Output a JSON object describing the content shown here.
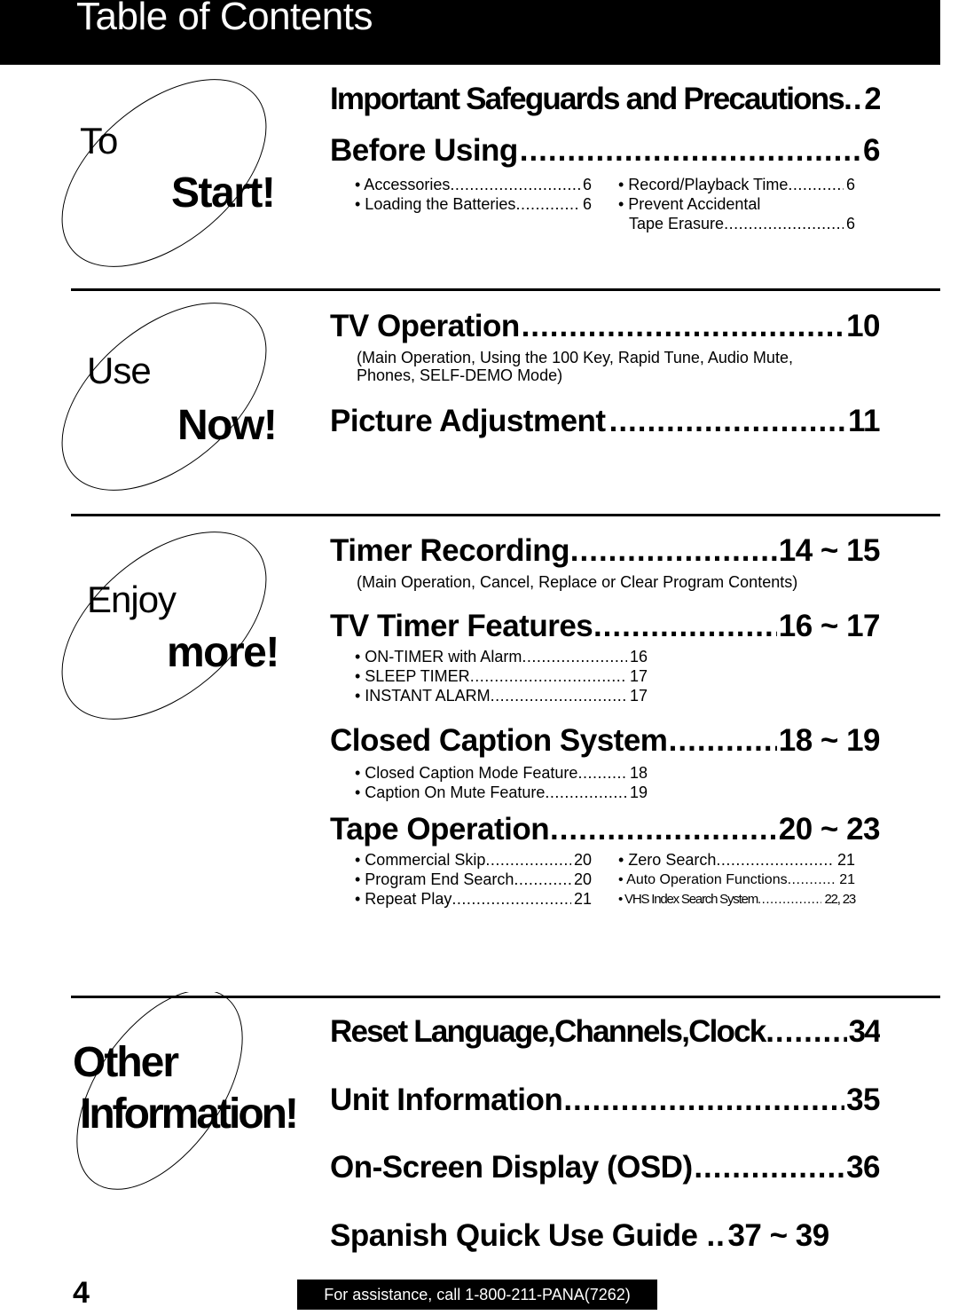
{
  "header": {
    "title": "Table of Contents"
  },
  "sections": [
    {
      "badge": {
        "word1": "To",
        "word2": "Start!"
      },
      "entries": [
        {
          "label": "Important Safeguards and Precautions",
          "page": "2"
        },
        {
          "label": "Before Using",
          "page": "6",
          "subitems_left": [
            {
              "label": "• Accessories",
              "page": "6"
            },
            {
              "label": "• Loading the Batteries",
              "page": "6"
            }
          ],
          "subitems_right": [
            {
              "label": "• Record/Playback Time",
              "page": "6"
            },
            {
              "label": "• Prevent Accidental",
              "page": ""
            },
            {
              "label": "Tape Erasure",
              "page": "6"
            }
          ]
        }
      ]
    },
    {
      "badge": {
        "word1": "Use",
        "word2": "Now!"
      },
      "entries": [
        {
          "label": "TV Operation",
          "page": "10",
          "note": "(Main Operation, Using the 100 Key, Rapid Tune, Audio Mute, Phones, SELF-DEMO Mode)"
        },
        {
          "label": "Picture Adjustment",
          "page": "11"
        }
      ]
    },
    {
      "badge": {
        "word1": "Enjoy",
        "word2": "more!"
      },
      "entries": [
        {
          "label": "Timer Recording",
          "page": "14 ~ 15",
          "note": "(Main Operation, Cancel, Replace or Clear Program Contents)"
        },
        {
          "label": "TV Timer Features",
          "page": "16 ~ 17",
          "subitems": [
            {
              "label": "• ON-TIMER with Alarm",
              "page": "16"
            },
            {
              "label": "• SLEEP TIMER",
              "page": "17"
            },
            {
              "label": "• INSTANT ALARM",
              "page": "17"
            }
          ]
        },
        {
          "label": "Closed Caption System",
          "page": "18 ~ 19",
          "subitems": [
            {
              "label": "• Closed Caption Mode Feature",
              "page": "18"
            },
            {
              "label": "• Caption On Mute Feature",
              "page": "19"
            }
          ]
        },
        {
          "label": "Tape Operation",
          "page": "20 ~ 23",
          "subitems_left": [
            {
              "label": "• Commercial Skip",
              "page": "20"
            },
            {
              "label": "• Program End Search",
              "page": "20"
            },
            {
              "label": "• Repeat Play",
              "page": "21"
            }
          ],
          "subitems_right": [
            {
              "label": "• Zero Search",
              "page": "21"
            },
            {
              "label": "• Auto Operation Functions",
              "page": "21"
            },
            {
              "label": "• VHS Index Search System",
              "page": "22, 23"
            }
          ]
        }
      ]
    },
    {
      "badge": {
        "word1": "Other",
        "word2": "Information!"
      },
      "entries": [
        {
          "label": "Reset Language,Channels,Clock",
          "page": "34"
        },
        {
          "label": "Unit Information",
          "page": "35"
        },
        {
          "label": "On-Screen Display (OSD)",
          "page": "36"
        },
        {
          "label": "Spanish Quick Use Guide",
          "page": "37 ~ 39"
        }
      ]
    }
  ],
  "footer": {
    "page_number": "4",
    "assistance": "For assistance, call 1-800-211-PANA(7262)"
  }
}
